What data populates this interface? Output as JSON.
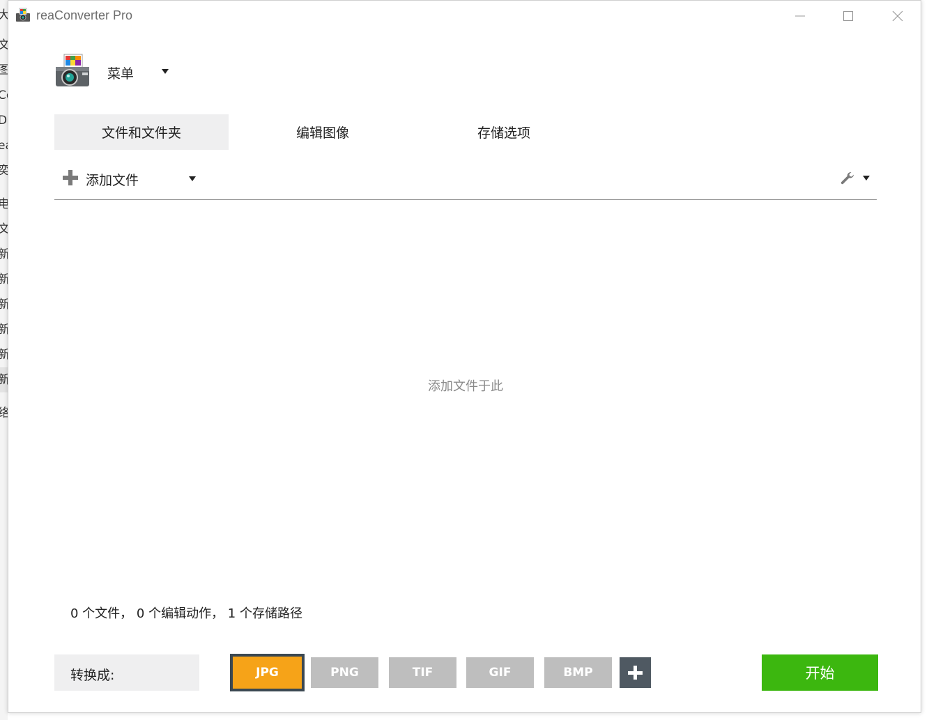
{
  "background_window": {
    "fragments": [
      "大",
      "文",
      "图",
      "Co",
      "De",
      "ea",
      "奕",
      "电",
      "文",
      "新",
      "新",
      "新",
      "新",
      "新",
      "新",
      "络"
    ]
  },
  "window": {
    "title": "reaConverter Pro"
  },
  "menu": {
    "label": "菜单"
  },
  "tabs": [
    {
      "label": "文件和文件夹",
      "active": true
    },
    {
      "label": "编辑图像",
      "active": false
    },
    {
      "label": "存储选项",
      "active": false
    }
  ],
  "toolbar": {
    "add_files_label": "添加文件"
  },
  "drop_zone": {
    "hint": "添加文件于此"
  },
  "status": {
    "text": "0 个文件， 0 个编辑动作， 1 个存储路径"
  },
  "convert": {
    "label": "转换成:",
    "formats": [
      {
        "label": "JPG",
        "selected": true
      },
      {
        "label": "PNG",
        "selected": false
      },
      {
        "label": "TIF",
        "selected": false
      },
      {
        "label": "GIF",
        "selected": false
      },
      {
        "label": "BMP",
        "selected": false
      }
    ],
    "start_label": "开始"
  },
  "colors": {
    "accent_selected": "#f6a318",
    "start_green": "#3cb70f",
    "format_inactive": "#bebebe",
    "add_format_bg": "#4f5962",
    "tab_active_bg": "#efeff0"
  },
  "icons": {
    "app": "app-camera-icon",
    "wrench": "wrench-icon",
    "add": "plus-icon"
  }
}
